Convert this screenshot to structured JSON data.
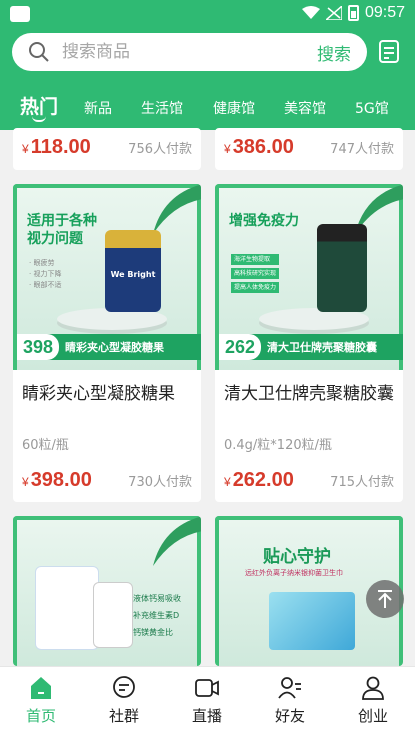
{
  "status": {
    "time": "09:57"
  },
  "search": {
    "placeholder": "搜索商品",
    "button": "搜索"
  },
  "tabs": [
    {
      "label": "热门",
      "active": true
    },
    {
      "label": "新品"
    },
    {
      "label": "生活馆"
    },
    {
      "label": "健康馆"
    },
    {
      "label": "美容馆"
    },
    {
      "label": "5G馆"
    }
  ],
  "colors": {
    "accent": "#2fba73",
    "price": "#d63b2b"
  },
  "products_top": [
    {
      "price": "118.00",
      "paid": "756人付款"
    },
    {
      "price": "386.00",
      "paid": "747人付款"
    }
  ],
  "products": [
    {
      "name": "睛彩夹心型凝胶糖果",
      "spec": "60粒/瓶",
      "price": "398.00",
      "paid": "730人付款",
      "img": {
        "headline": "适用于各种\n视力问题",
        "bullets": [
          "· 眼疲劳",
          "· 视力下降",
          "· 眼部不适"
        ],
        "bottle_text": "We Bright",
        "badge_price": "398",
        "badge_name": "睛彩夹心型凝胶糖果"
      }
    },
    {
      "name": "清大卫仕牌壳聚糖胶囊",
      "spec": "0.4g/粒*120粒/瓶",
      "price": "262.00",
      "paid": "715人付款",
      "img": {
        "headline": "增强免疫力",
        "bullets": [
          "海洋生物提取",
          "高科技研究实现",
          "提高人体免疫力"
        ],
        "badge_price": "262",
        "badge_name": "清大卫仕牌壳聚糖胶囊"
      }
    }
  ],
  "products_bottom": [
    {
      "img_labels": [
        "液体钙易吸收",
        "补充维生素D",
        "钙镁黄金比"
      ]
    },
    {
      "img_headline": "贴心守护",
      "img_sub": "远红外负离子纳米银抑菌卫生巾"
    }
  ],
  "yen": "¥",
  "bottom_nav": [
    {
      "label": "首页",
      "icon": "home-icon",
      "active": true
    },
    {
      "label": "社群",
      "icon": "chat-icon"
    },
    {
      "label": "直播",
      "icon": "video-icon"
    },
    {
      "label": "好友",
      "icon": "friends-icon"
    },
    {
      "label": "创业",
      "icon": "profile-icon"
    }
  ]
}
